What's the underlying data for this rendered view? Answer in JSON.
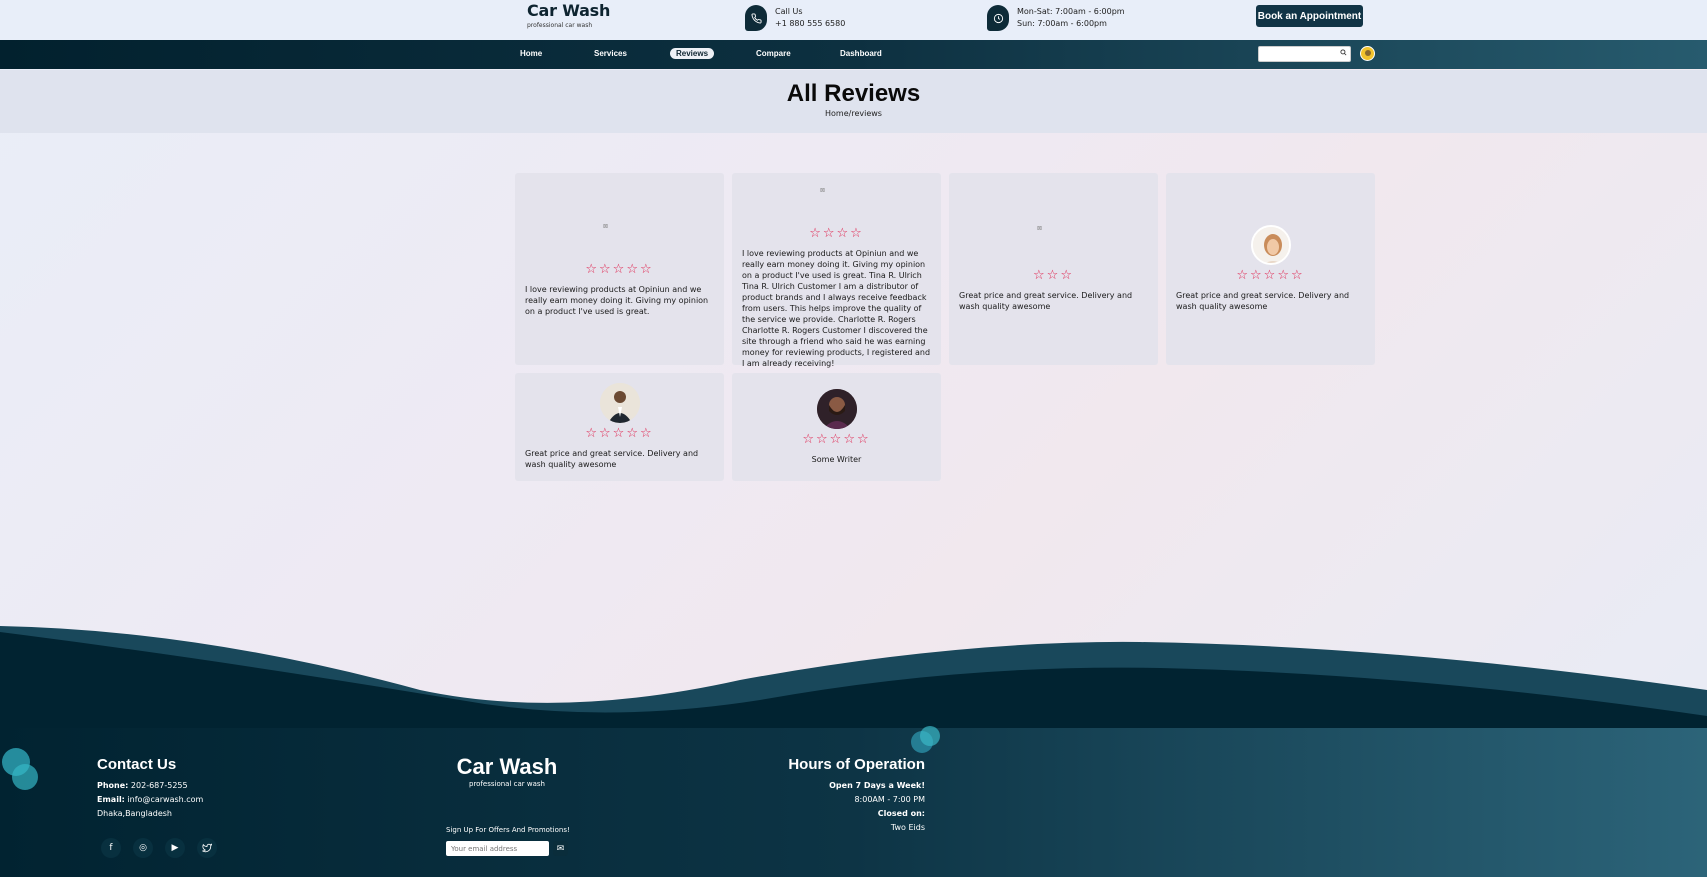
{
  "header": {
    "brand_title": "Car Wash",
    "brand_subtitle": "professional car wash",
    "call_label": "Call Us",
    "call_number": "+1 880 555 6580",
    "hours_weekday": "Mon-Sat: 7:00am - 6:00pm",
    "hours_sunday": "Sun: 7:00am - 6:00pm",
    "appointment_label": "Book an Appointment",
    "phone_icon": "phone-icon",
    "clock_icon": "clock-icon"
  },
  "nav": {
    "items": [
      {
        "label": "Home",
        "active": false
      },
      {
        "label": "Services",
        "active": false
      },
      {
        "label": "Reviews",
        "active": true
      },
      {
        "label": "Compare",
        "active": false
      },
      {
        "label": "Dashboard",
        "active": false
      }
    ],
    "search_placeholder": "",
    "search_icon": "search-icon"
  },
  "hero": {
    "title": "All Reviews",
    "breadcrumb": "Home/reviews"
  },
  "reviews": [
    {
      "text": "I love reviewing products at Opiniun and we really earn money doing it. Giving my opinion on a product I've used is great.",
      "stars": 5,
      "image": "broken"
    },
    {
      "text": "I love reviewing products at Opiniun and we really earn money doing it. Giving my opinion on a product I've used is great. Tina R. Ulrich Tina R. Ulrich Customer I am a distributor of product brands and I always receive feedback from users. This helps improve the quality of the service we provide. Charlotte R. Rogers Charlotte R. Rogers Customer I discovered the site through a friend who said he was earning money for reviewing products, I registered and I am already receiving!",
      "stars": 4,
      "image": "broken"
    },
    {
      "text": "Great price and great service. Delivery and wash quality awesome",
      "stars": 3,
      "image": "broken"
    },
    {
      "text": "Great price and great service. Delivery and wash quality awesome",
      "stars": 5,
      "image": "woman-avatar"
    },
    {
      "text": "Great price and great service. Delivery and wash quality awesome",
      "stars": 5,
      "image": "man-suit-avatar"
    },
    {
      "text": "Some Writer",
      "stars": 5,
      "image": "man-beard-avatar"
    }
  ],
  "footer": {
    "contact_title": "Contact Us",
    "phone_label": "Phone:",
    "phone_value": "202-687-5255",
    "email_label": "Email:",
    "email_value": "info@carwash.com",
    "address": "Dhaka,Bangladesh",
    "brand_title": "Car Wash",
    "brand_subtitle": "professional car wash",
    "signup_label": "Sign Up For Offers And Promotions!",
    "email_placeholder": "Your email address",
    "hours_title": "Hours of Operation",
    "open_label": "Open 7 Days a Week!",
    "open_hours": "8:00AM - 7:00 PM",
    "closed_label": "Closed on:",
    "closed_value": "Two Eids",
    "social_icons": [
      "facebook-icon",
      "instagram-icon",
      "youtube-icon",
      "twitter-icon"
    ]
  },
  "colors": {
    "navy": "#0e2b38",
    "star": "#e0244f",
    "footer_start": "#012331",
    "footer_end": "#2c6479",
    "accent_teal": "#2aa3b5"
  }
}
